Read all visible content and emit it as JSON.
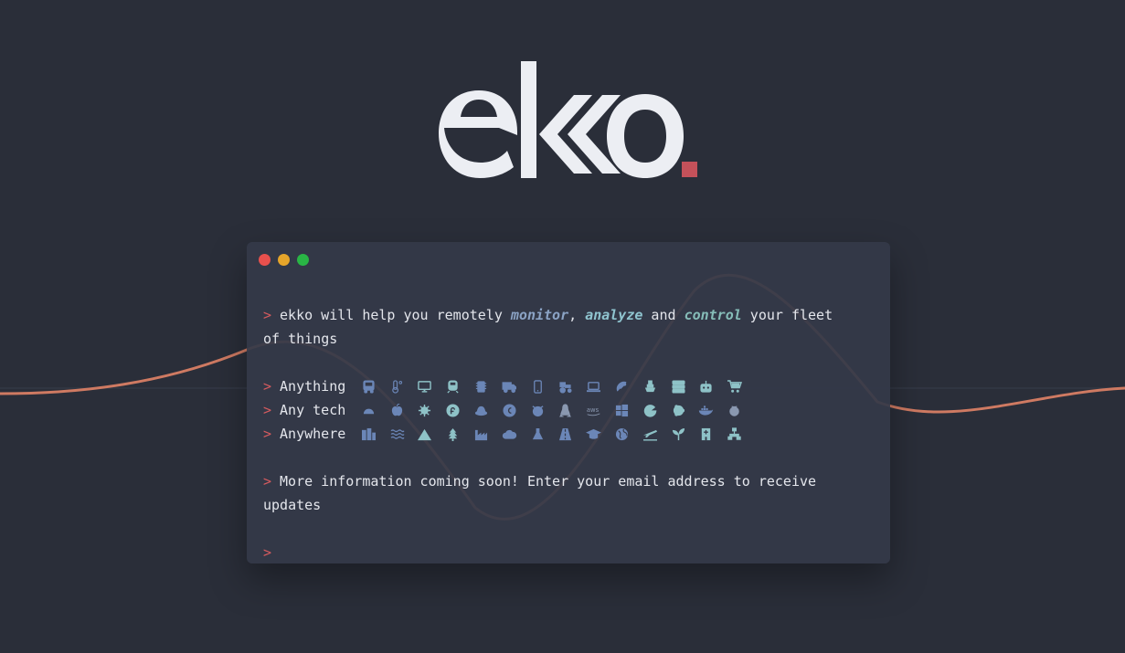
{
  "brand": {
    "logo_text": "ekko",
    "accent_color": "#c4515a",
    "logo_color": "#eceef3"
  },
  "window": {
    "controls": [
      "close",
      "minimize",
      "maximize"
    ]
  },
  "terminal": {
    "prompt_symbol": ">",
    "intro": {
      "prefix": "ekko will help you remotely ",
      "word1": "monitor",
      "sep1": ", ",
      "word2": "analyze",
      "sep2": " and ",
      "word3": "control",
      "suffix_a": " your fleet",
      "suffix_b": "of things"
    },
    "rows": [
      {
        "label": "Anything",
        "icons": [
          "bus-icon",
          "thermometer-icon",
          "monitor-icon",
          "train-icon",
          "chip-icon",
          "truck-icon",
          "smartphone-icon",
          "tractor-icon",
          "laptop-icon",
          "satellite-icon",
          "ship-icon",
          "server-icon",
          "robot-icon",
          "shopping-cart-icon"
        ]
      },
      {
        "label": "Any tech",
        "icons": [
          "android-icon",
          "apple-icon",
          "raspberry-gear-icon",
          "fedora-icon",
          "redhat-icon",
          "debian-icon",
          "freebsd-icon",
          "linux-icon",
          "aws-icon",
          "windows-icon",
          "google-icon",
          "ubuntu-icon",
          "docker-icon",
          "raspberry-pi-icon"
        ]
      },
      {
        "label": "Anywhere",
        "icons": [
          "city-icon",
          "water-icon",
          "mountain-icon",
          "tree-icon",
          "factory-icon",
          "cloud-icon",
          "lab-flask-icon",
          "road-icon",
          "school-icon",
          "globe-icon",
          "airport-icon",
          "plant-icon",
          "hospital-icon",
          "network-icon"
        ]
      }
    ],
    "info_a": "More information coming soon! Enter your email address to receive",
    "info_b": "updates",
    "input_value": ""
  },
  "colors": {
    "background": "#2a2e39",
    "wave": "#cf7a62",
    "prompt": "#d65b5f"
  }
}
